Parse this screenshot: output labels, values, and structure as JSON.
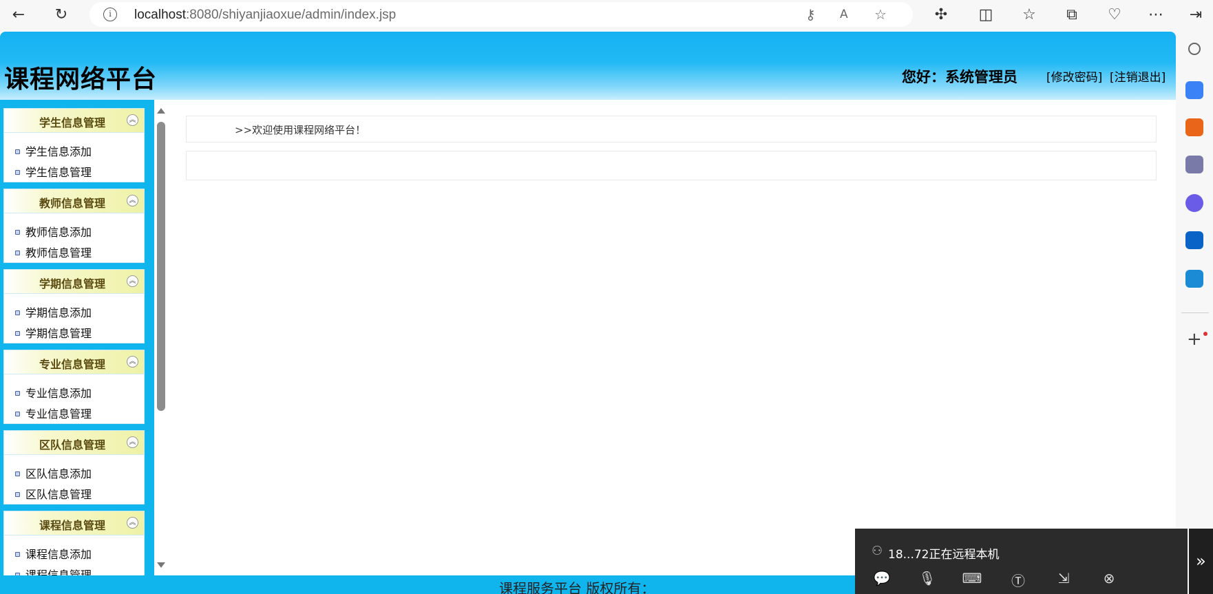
{
  "browser": {
    "url_host": "localhost",
    "url_path": ":8080/shiyanjiaoxue/admin/index.jsp"
  },
  "header": {
    "site_title": "课程网络平台",
    "greeting": "您好：系统管理员",
    "change_password": "[修改密码]",
    "logout": "[注销退出]"
  },
  "sidebar": {
    "groups": [
      {
        "title": "学生信息管理",
        "items": [
          "学生信息添加",
          "学生信息管理"
        ]
      },
      {
        "title": "教师信息管理",
        "items": [
          "教师信息添加",
          "教师信息管理"
        ]
      },
      {
        "title": "学期信息管理",
        "items": [
          "学期信息添加",
          "学期信息管理"
        ]
      },
      {
        "title": "专业信息管理",
        "items": [
          "专业信息添加",
          "专业信息管理"
        ]
      },
      {
        "title": "区队信息管理",
        "items": [
          "区队信息添加",
          "区队信息管理"
        ]
      },
      {
        "title": "课程信息管理",
        "items": [
          "课程信息添加",
          "课程信息管理"
        ]
      }
    ]
  },
  "main": {
    "welcome": ">>欢迎使用课程网络平台！"
  },
  "footer": {
    "text": "课程服务平台 版权所有："
  },
  "remote_session": {
    "status": "18...72正在远程本机"
  },
  "colors": {
    "header_blue": "#14b1f2",
    "sidebar_blue": "#10b5ee",
    "group_header": "#eef2a6"
  }
}
